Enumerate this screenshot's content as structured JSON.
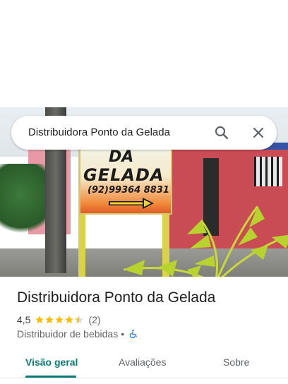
{
  "search": {
    "query": "Distribuidora Ponto da Gelada"
  },
  "photo": {
    "sign_line1": "DA",
    "sign_line2": "GELADA",
    "sign_phone": "(92)99364 8831"
  },
  "place": {
    "name": "Distribuidora Ponto da Gelada",
    "rating": "4,5",
    "stars": 4.5,
    "review_count": "(2)",
    "category": "Distribuidor de bebidas",
    "separator": "•",
    "accessibility_icon": "wheelchair-icon"
  },
  "tabs": [
    {
      "label": "Visão geral",
      "active": true
    },
    {
      "label": "Avaliações",
      "active": false
    },
    {
      "label": "Sobre",
      "active": false
    }
  ],
  "colors": {
    "accent": "#0b7a75",
    "star": "#fbbc04",
    "accessibility": "#1a73e8"
  }
}
